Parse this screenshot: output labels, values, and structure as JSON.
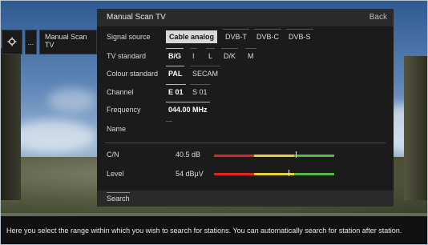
{
  "breadcrumb": {
    "more": "...",
    "item_label": "Manual Scan TV"
  },
  "panel": {
    "title": "Manual Scan TV",
    "back_label": "Back"
  },
  "signal_source": {
    "label": "Signal source",
    "options": [
      "Cable analog",
      "DVB-T",
      "DVB-C",
      "DVB-S"
    ],
    "selected": "Cable analog"
  },
  "tv_standard": {
    "label": "TV standard",
    "options": [
      "B/G",
      "I",
      "L",
      "D/K",
      "M"
    ],
    "selected": "B/G"
  },
  "colour_standard": {
    "label": "Colour standard",
    "options": [
      "PAL",
      "SECAM"
    ],
    "selected": "PAL"
  },
  "channel": {
    "label": "Channel",
    "options": [
      "E 01",
      "S 01"
    ],
    "selected": "E 01"
  },
  "frequency": {
    "label": "Frequency",
    "value": "044.00 MHz"
  },
  "name": {
    "label": "Name",
    "value": ""
  },
  "cn": {
    "label": "C/N",
    "value": "40.5 dB",
    "level": 0.68
  },
  "level": {
    "label": "Level",
    "value": "54 dBµV",
    "level": 0.62
  },
  "footer": {
    "search_label": "Search"
  },
  "help_text": "Here you select the range within which you wish to search for stations. You can automatically search for station after station.",
  "colors": {
    "panel": "#1b1b1b",
    "selected_bg": "#d9d9d9",
    "meter_red": "#e02424",
    "meter_yellow": "#e6d22a",
    "meter_green": "#58b94a"
  }
}
